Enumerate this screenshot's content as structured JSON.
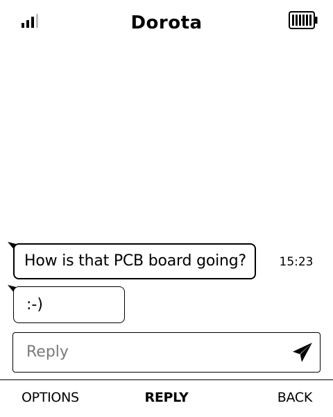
{
  "status_bar": {
    "signal_icon": "signal-icon",
    "battery_icon": "battery-icon",
    "title": "Dorota"
  },
  "conversation": {
    "messages": [
      {
        "text": "How is that PCB board going?",
        "time": "15:23"
      },
      {
        "text": ":-)"
      }
    ]
  },
  "reply": {
    "placeholder": "Reply",
    "value": "",
    "send_icon": "send-icon"
  },
  "softkeys": {
    "left": "OPTIONS",
    "center": "REPLY",
    "right": "BACK"
  }
}
